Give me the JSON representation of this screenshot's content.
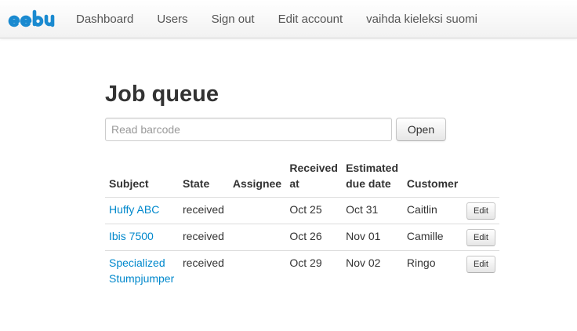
{
  "navbar": {
    "brand": "eebu",
    "brand_color": "#1a8ad0",
    "links": [
      {
        "label": "Dashboard"
      },
      {
        "label": "Users"
      },
      {
        "label": "Sign out"
      },
      {
        "label": "Edit account"
      },
      {
        "label": "vaihda kieleksi suomi"
      }
    ]
  },
  "main": {
    "title": "Job queue",
    "barcode_placeholder": "Read barcode",
    "barcode_value": "",
    "open_label": "Open"
  },
  "table": {
    "headers": [
      "Subject",
      "State",
      "Assignee",
      "Received at",
      "Estimated due date",
      "Customer",
      ""
    ],
    "rows": [
      {
        "subject": "Huffy ABC",
        "state": "received",
        "assignee": "",
        "received": "Oct 25",
        "due": "Oct 31",
        "customer": "Caitlin",
        "action": "Edit"
      },
      {
        "subject": "Ibis 7500",
        "state": "received",
        "assignee": "",
        "received": "Oct 26",
        "due": "Nov 01",
        "customer": "Camille",
        "action": "Edit"
      },
      {
        "subject": "Specialized Stumpjumper",
        "state": "received",
        "assignee": "",
        "received": "Oct 29",
        "due": "Nov 02",
        "customer": "Ringo",
        "action": "Edit"
      }
    ]
  },
  "colors": {
    "link": "#0088cc",
    "text": "#333333"
  }
}
